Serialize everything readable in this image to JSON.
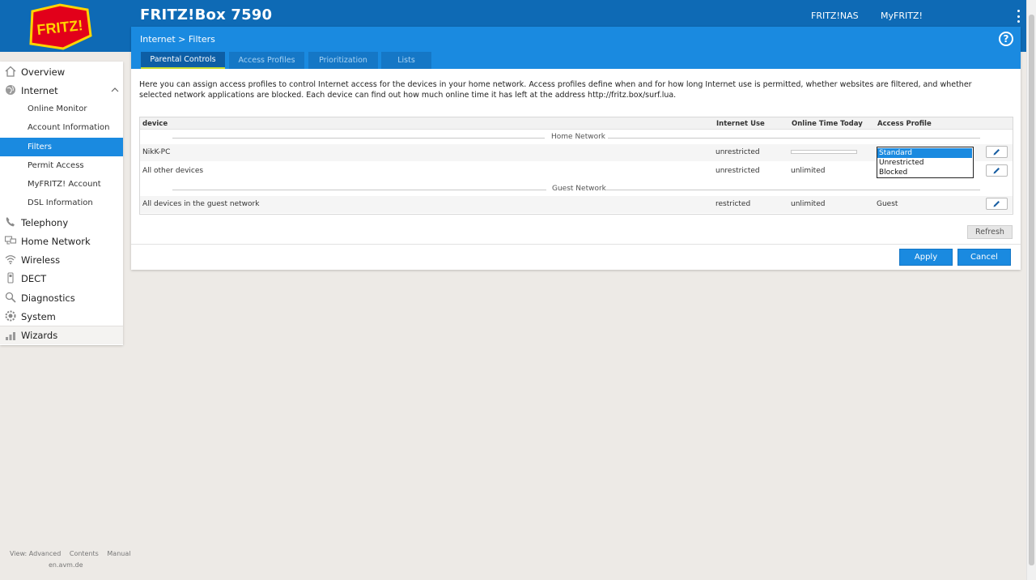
{
  "header": {
    "product_title": "FRITZ!Box 7590",
    "links": [
      "FRITZ!NAS",
      "MyFRITZ!"
    ],
    "logo_text": "FRITZ!"
  },
  "sidebar": {
    "items": [
      {
        "label": "Overview",
        "icon": "home-icon"
      },
      {
        "label": "Internet",
        "icon": "globe-icon"
      },
      {
        "label": "Online Monitor"
      },
      {
        "label": "Account Information"
      },
      {
        "label": "Filters"
      },
      {
        "label": "Permit Access"
      },
      {
        "label": "MyFRITZ! Account"
      },
      {
        "label": "DSL Information"
      },
      {
        "label": "Telephony",
        "icon": "phone-icon"
      },
      {
        "label": "Home Network",
        "icon": "network-icon"
      },
      {
        "label": "Wireless",
        "icon": "wifi-icon"
      },
      {
        "label": "DECT",
        "icon": "dect-icon"
      },
      {
        "label": "Diagnostics",
        "icon": "diagnostics-icon"
      },
      {
        "label": "System",
        "icon": "gear-icon"
      },
      {
        "label": "Wizards",
        "icon": "wand-icon"
      }
    ],
    "footer": {
      "view": "View: Advanced",
      "contents": "Contents",
      "manual": "Manual",
      "site": "en.avm.de"
    }
  },
  "panel": {
    "breadcrumb": "Internet > Filters",
    "help": "?",
    "tabs": [
      "Parental Controls",
      "Access Profiles",
      "Prioritization",
      "Lists"
    ],
    "active_tab": "Parental Controls",
    "description": "Here you can assign access profiles to control Internet access for the devices in your home network. Access profiles define when and for how long Internet use is permitted, whether websites are filtered, and whether selected network applications are blocked. Each device can find out how much online time it has left at the address http://fritz.box/surf.lua.",
    "table": {
      "headers": {
        "device": "device",
        "internet_use": "Internet Use",
        "online_time": "Online Time Today",
        "access_profile": "Access Profile"
      },
      "groups": {
        "home": "Home Network",
        "guest": "Guest Network"
      },
      "rows": [
        {
          "device": "NikK-PC",
          "internet_use": "unrestricted",
          "online_time": "",
          "online_time_fraction": 0.0,
          "profile": "Standard"
        },
        {
          "device": "All other devices",
          "internet_use": "unrestricted",
          "online_time": "unlimited",
          "profile": ""
        },
        {
          "device": "All devices in the guest network",
          "internet_use": "restricted",
          "online_time": "unlimited",
          "profile": "Guest"
        }
      ],
      "profile_options": [
        "Standard",
        "Unrestricted",
        "Blocked"
      ],
      "selected_profile": "Standard"
    },
    "buttons": {
      "refresh": "Refresh",
      "apply": "Apply",
      "cancel": "Cancel"
    }
  },
  "colors": {
    "header_blue": "#0e6ab5",
    "accent_blue": "#1a8ae0",
    "tab_active_underline": "#c8dc2c",
    "background": "#edeae6"
  }
}
